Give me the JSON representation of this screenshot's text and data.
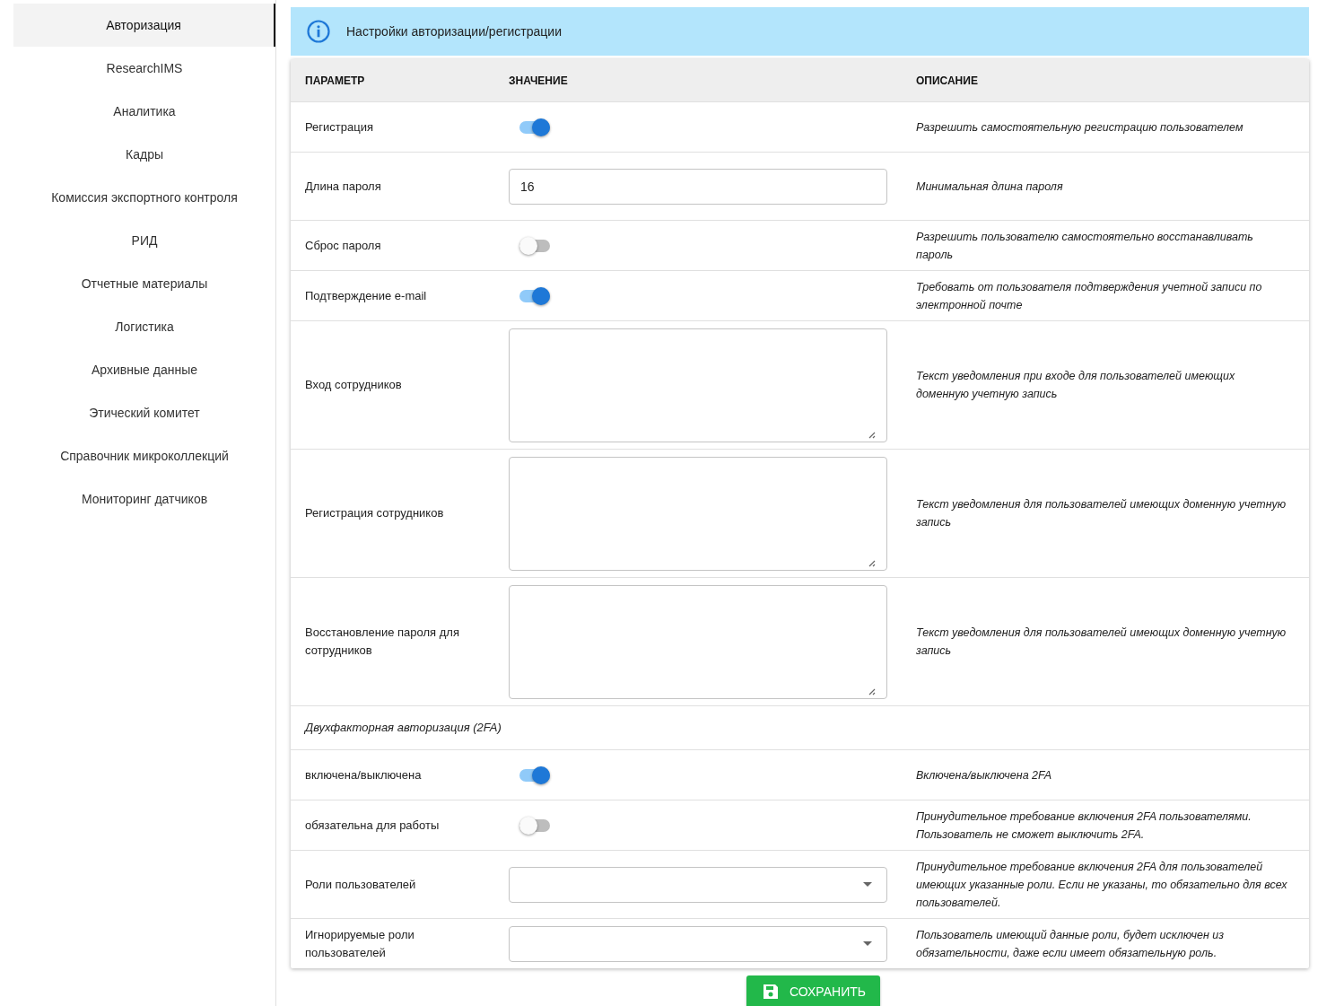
{
  "sidebar": {
    "items": [
      {
        "label": "Авторизация",
        "selected": true
      },
      {
        "label": "ResearchIMS",
        "selected": false
      },
      {
        "label": "Аналитика",
        "selected": false
      },
      {
        "label": "Кадры",
        "selected": false
      },
      {
        "label": "Комиссия экспортного контроля",
        "selected": false
      },
      {
        "label": "РИД",
        "selected": false
      },
      {
        "label": "Отчетные материалы",
        "selected": false
      },
      {
        "label": "Логистика",
        "selected": false
      },
      {
        "label": "Архивные данные",
        "selected": false
      },
      {
        "label": "Этический комитет",
        "selected": false
      },
      {
        "label": "Справочник микроколлекций",
        "selected": false
      },
      {
        "label": "Мониторинг датчиков",
        "selected": false
      }
    ]
  },
  "alert": {
    "text": "Настройки авторизации/регистрации"
  },
  "table": {
    "columns": [
      "ПАРАМЕТР",
      "ЗНАЧЕНИЕ",
      "ОПИСАНИЕ"
    ],
    "rows": [
      {
        "kind": "toggle",
        "parameter": "Регистрация",
        "on": true,
        "description": "Разрешить самостоятельную регистрацию пользователем"
      },
      {
        "kind": "text",
        "parameter": "Длина пароля",
        "value": "16",
        "description": "Минимальная длина пароля"
      },
      {
        "kind": "toggle",
        "parameter": "Сброс пароля",
        "on": false,
        "description": "Разрешить пользователю самостоятельно восстанавливать пароль"
      },
      {
        "kind": "toggle",
        "parameter": "Подтверждение e-mail",
        "on": true,
        "description": "Требовать от пользователя подтверждения учетной записи по электронной почте"
      },
      {
        "kind": "textarea",
        "parameter": "Вход сотрудников",
        "description": "Текст уведомления при входе для пользователей имеющих доменную учетную запись"
      },
      {
        "kind": "textarea",
        "parameter": "Регистрация сотрудников",
        "description": "Текст уведомления для пользователей имеющих доменную учетную запись"
      },
      {
        "kind": "textarea",
        "parameter": "Восстановление пароля для сотрудников",
        "description": "Текст уведомления для пользователей имеющих доменную учетную запись"
      },
      {
        "kind": "section",
        "parameter": "Двухфакторная авторизация (2FA)"
      },
      {
        "kind": "toggle",
        "parameter": "включена/выключена",
        "on": true,
        "description": "Включена/выключена 2FA"
      },
      {
        "kind": "toggle",
        "parameter": "обязательна для работы",
        "on": false,
        "description": "Принудительное требование включения 2FA пользователями. Пользователь не сможет выключить 2FA."
      },
      {
        "kind": "select",
        "parameter": "Роли пользователей",
        "description": "Принудительное требование включения 2FA для пользователей имеющих указанные роли. Если не указаны, то обязательно для всех пользователей."
      },
      {
        "kind": "select",
        "parameter": "Игнорируемые роли пользователей",
        "description": "Пользователь имеющий данные роли, будет исключен из обязательности, даже если имеет обязательную роль."
      }
    ]
  },
  "save_button": {
    "label": "СОХРАНИТЬ"
  }
}
